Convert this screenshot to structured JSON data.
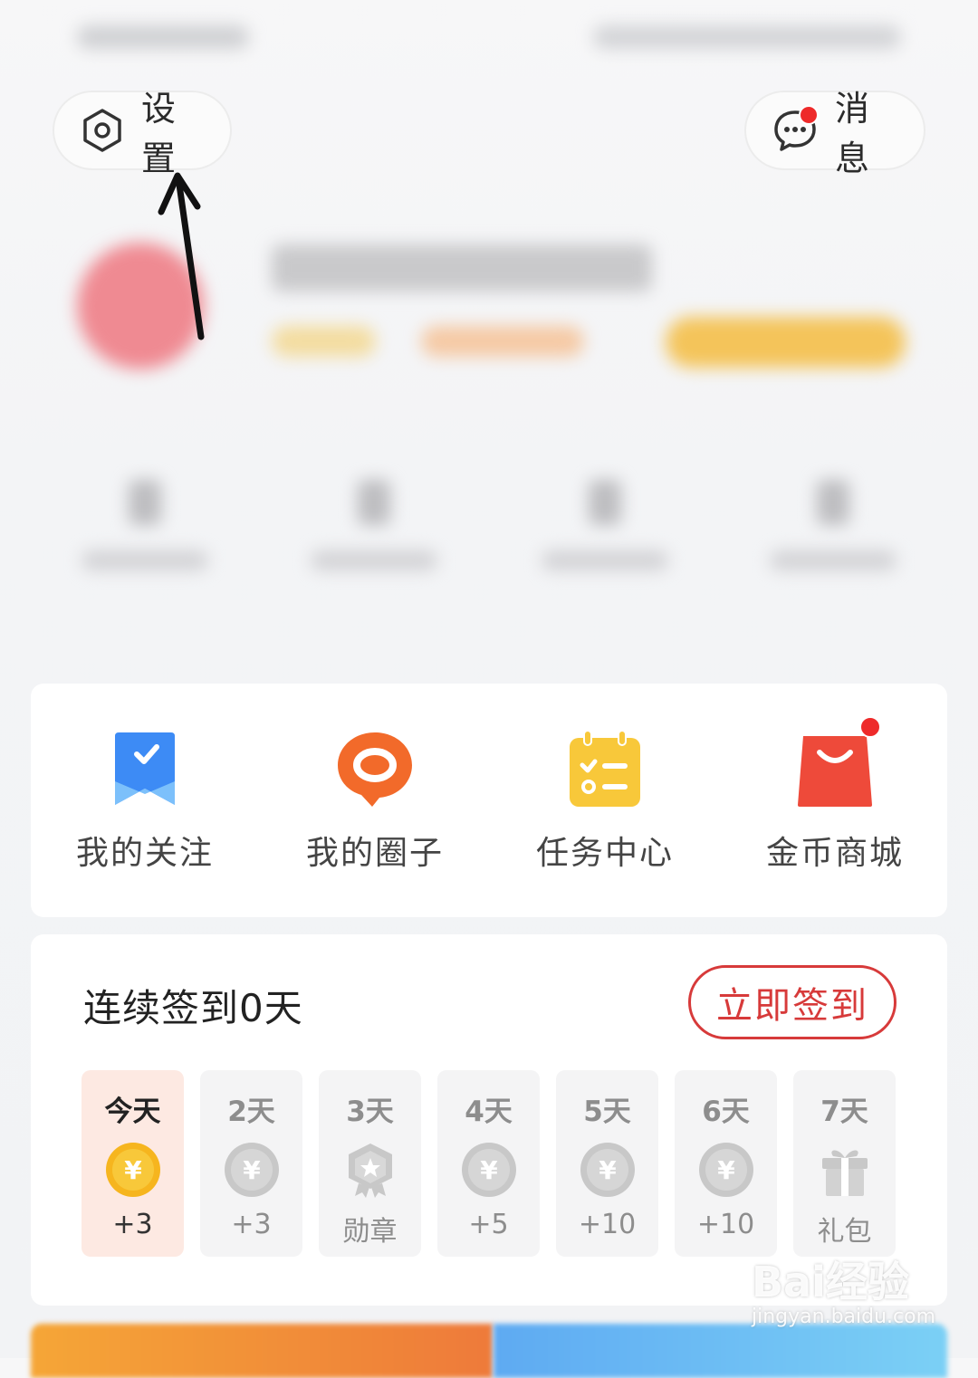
{
  "header": {
    "settings_label": "设置",
    "messages_label": "消息"
  },
  "shortcuts": [
    {
      "label": "我的关注",
      "icon": "bookmark-check-icon",
      "color": "#3d8bf5"
    },
    {
      "label": "我的圈子",
      "icon": "chat-circle-icon",
      "color": "#f26a2a"
    },
    {
      "label": "任务中心",
      "icon": "task-calendar-icon",
      "color": "#f8c83a"
    },
    {
      "label": "金币商城",
      "icon": "shopping-bag-icon",
      "color": "#ee4a3a"
    }
  ],
  "sign_in": {
    "title": "连续签到0天",
    "button": "立即签到",
    "days": [
      {
        "day": "今天",
        "reward": "+3",
        "icon": "coin-icon"
      },
      {
        "day": "2天",
        "reward": "+3",
        "icon": "coin-icon"
      },
      {
        "day": "3天",
        "reward": "勋章",
        "icon": "medal-icon"
      },
      {
        "day": "4天",
        "reward": "+5",
        "icon": "coin-icon"
      },
      {
        "day": "5天",
        "reward": "+10",
        "icon": "coin-icon"
      },
      {
        "day": "6天",
        "reward": "+10",
        "icon": "coin-icon"
      },
      {
        "day": "7天",
        "reward": "礼包",
        "icon": "gift-icon"
      }
    ]
  },
  "watermark": {
    "logo": "Bai经验",
    "url": "jingyan.baidu.com"
  },
  "colors": {
    "accent_red": "#d73a3a",
    "today_bg": "#fde9e2",
    "coin_gold": "#f6b51e"
  }
}
